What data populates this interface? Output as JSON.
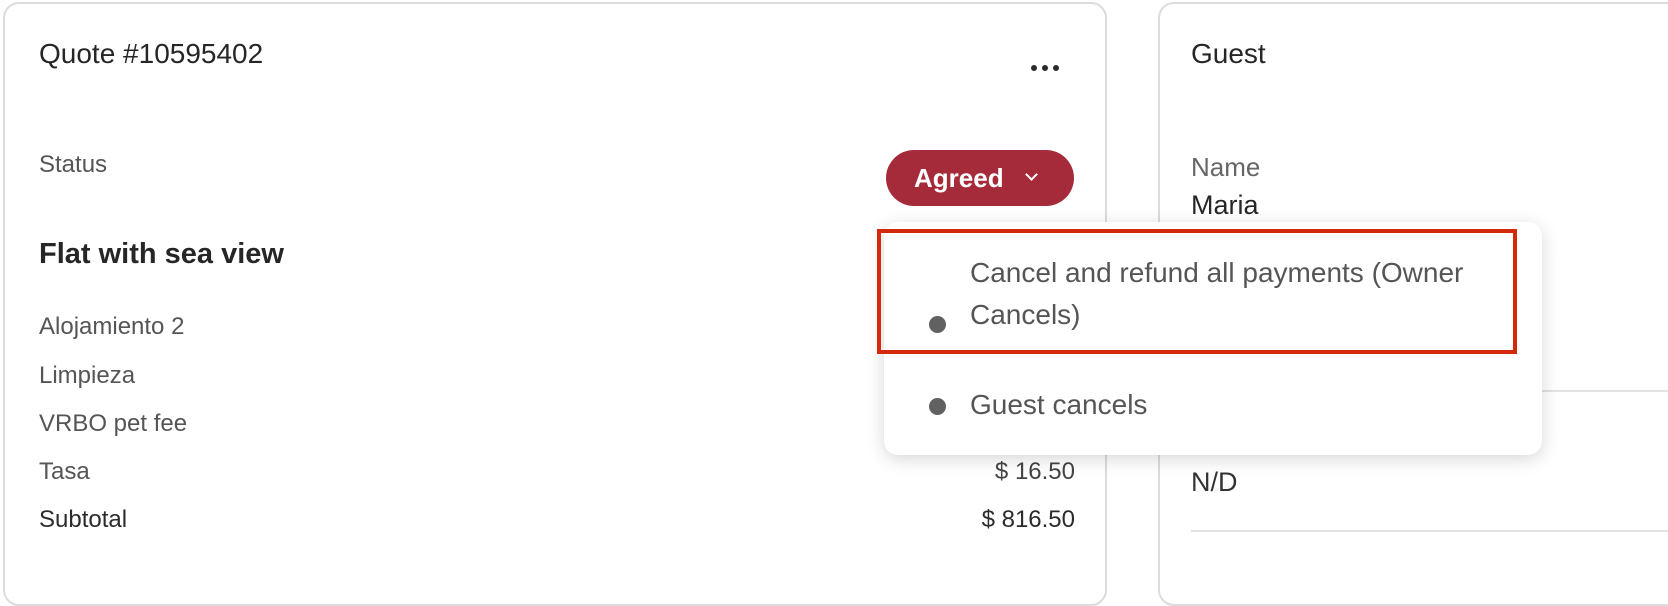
{
  "quote": {
    "title": "Quote #10595402",
    "menu_icon": "more-horizontal-icon",
    "status_label": "Status",
    "status_value": "Agreed",
    "status_color": "#a52a3a",
    "property_title": "Flat with sea view",
    "lines": [
      {
        "label": "Alojamiento 2",
        "value": ""
      },
      {
        "label": "Limpieza",
        "value": ""
      },
      {
        "label": "VRBO pet fee",
        "value": ""
      },
      {
        "label": "Tasa",
        "value": "$ 16.50"
      }
    ],
    "subtotal": {
      "label": "Subtotal",
      "value": "$ 816.50"
    }
  },
  "guest": {
    "title": "Guest",
    "name_label": "Name",
    "name_value": "Maria",
    "other_value": "N/D"
  },
  "status_dropdown": {
    "options": [
      {
        "label": "Cancel and refund all payments (Owner Cancels)",
        "highlighted": true
      },
      {
        "label": "Guest cancels",
        "highlighted": false
      }
    ],
    "highlight_color": "#d42a0c"
  }
}
